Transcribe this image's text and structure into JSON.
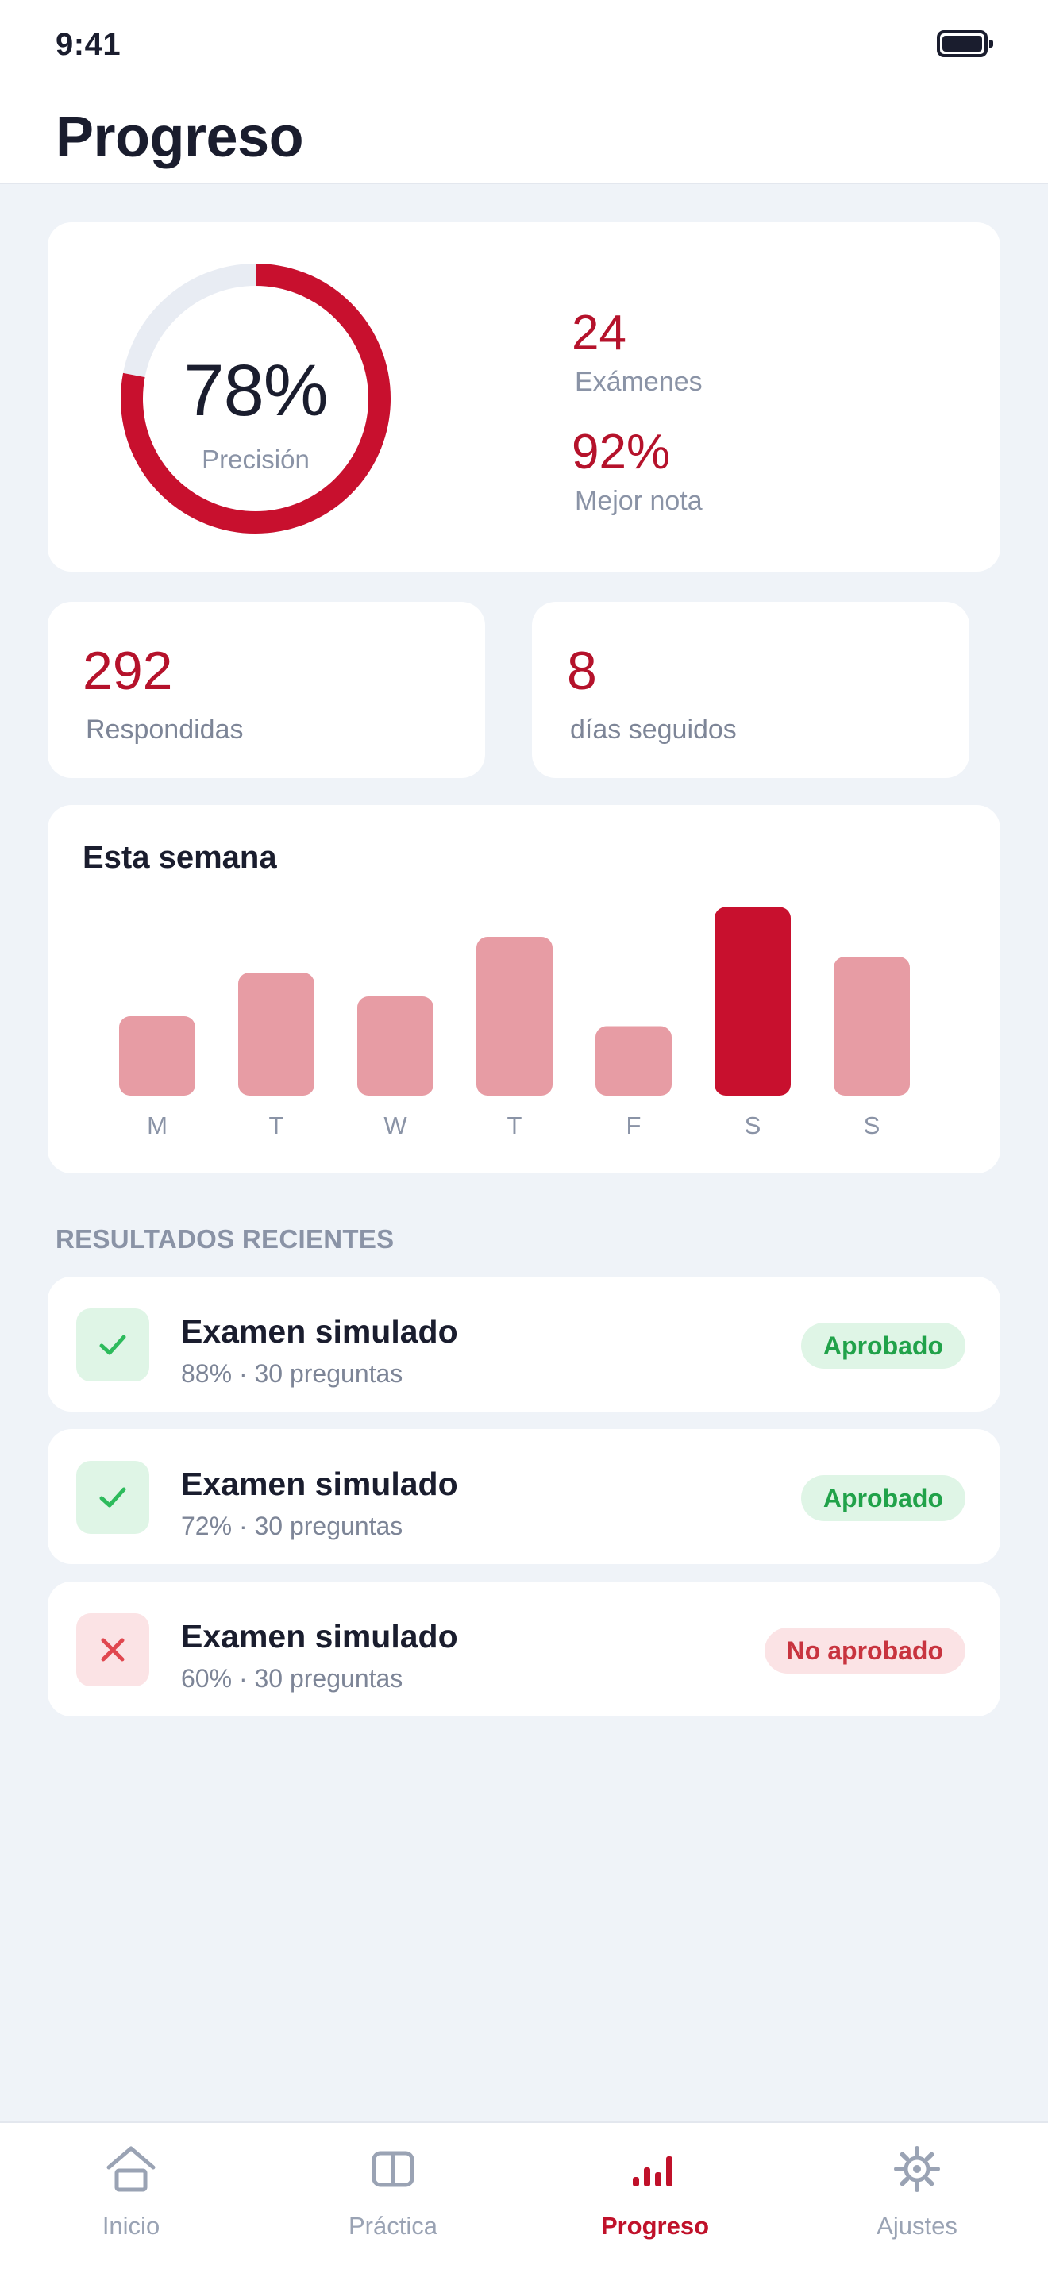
{
  "status_bar": {
    "time": "9:41"
  },
  "header": {
    "title": "Progreso"
  },
  "summary": {
    "accuracy": {
      "value": "78%",
      "label": "Precisión",
      "fraction": 0.78
    },
    "exams": {
      "value": "24",
      "label": "Exámenes"
    },
    "best": {
      "value": "92%",
      "label": "Mejor nota"
    }
  },
  "stats": [
    {
      "value": "292",
      "label": "Respondidas"
    },
    {
      "value": "8",
      "label": "días seguidos"
    }
  ],
  "week": {
    "title": "Esta semana",
    "chart_data": {
      "type": "bar",
      "categories": [
        "M",
        "T",
        "W",
        "T",
        "F",
        "S",
        "S"
      ],
      "values": [
        40,
        62,
        50,
        80,
        35,
        95,
        70
      ],
      "highlight_index": 5,
      "ylim": [
        0,
        100
      ],
      "colors": {
        "bar": "#e79ca4",
        "highlight": "#c8102e",
        "label": "#8a93a6"
      }
    }
  },
  "recent": {
    "title": "RESULTADOS RECIENTES",
    "items": [
      {
        "title": "Examen simulado",
        "subtitle": "88% · 30 preguntas",
        "status": "Aprobado",
        "passed": true,
        "icon": "check-icon"
      },
      {
        "title": "Examen simulado",
        "subtitle": "72% · 30 preguntas",
        "status": "Aprobado",
        "passed": true,
        "icon": "check-icon"
      },
      {
        "title": "Examen simulado",
        "subtitle": "60% · 30 preguntas",
        "status": "No aprobado",
        "passed": false,
        "icon": "x-icon"
      }
    ]
  },
  "tabs": [
    {
      "label": "Inicio",
      "icon": "home-icon"
    },
    {
      "label": "Práctica",
      "icon": "book-icon"
    },
    {
      "label": "Progreso",
      "icon": "chart-icon",
      "active": true
    },
    {
      "label": "Ajustes",
      "icon": "gear-icon"
    }
  ],
  "colors": {
    "accent": "#c8102e",
    "pass": "#21a24a",
    "fail": "#c8343f"
  }
}
